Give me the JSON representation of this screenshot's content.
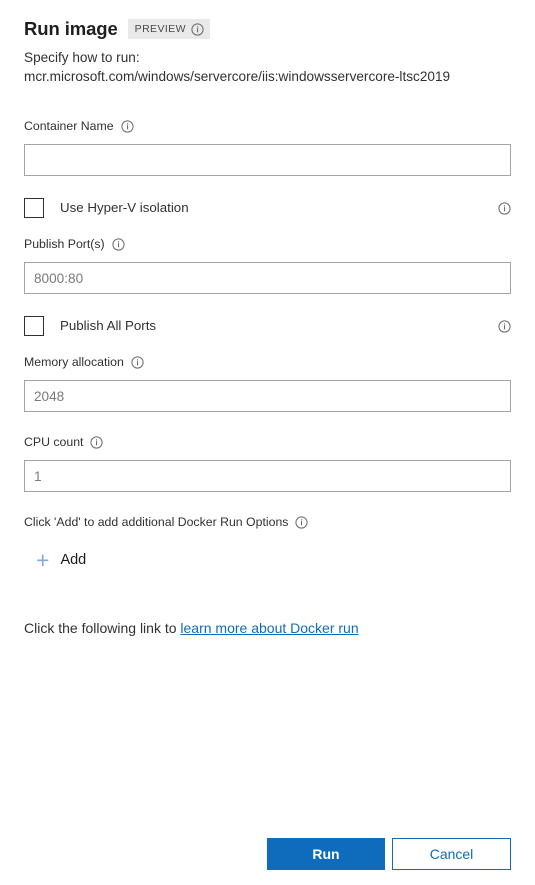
{
  "header": {
    "title": "Run image",
    "preview_badge": "PREVIEW",
    "preview_info_icon": "info-icon",
    "subtitle_line1": "Specify how to run:",
    "subtitle_line2": "mcr.microsoft.com/windows/servercore/iis:windowsservercore-ltsc2019"
  },
  "fields": {
    "container_name": {
      "label": "Container Name",
      "info_icon": "info-icon",
      "value": "",
      "placeholder": ""
    },
    "hyperv_isolation": {
      "label": "Use Hyper-V isolation",
      "checked": false,
      "info_icon": "info-icon"
    },
    "publish_ports": {
      "label": "Publish Port(s)",
      "info_icon": "info-icon",
      "value": "",
      "placeholder": "8000:80"
    },
    "publish_all_ports": {
      "label": "Publish All Ports",
      "checked": false,
      "info_icon": "info-icon"
    },
    "memory_allocation": {
      "label": "Memory allocation",
      "info_icon": "info-icon",
      "value": "",
      "placeholder": "2048"
    },
    "cpu_count": {
      "label": "CPU count",
      "info_icon": "info-icon",
      "value": "",
      "placeholder": "1"
    }
  },
  "run_options": {
    "label": "Click 'Add' to add additional Docker Run Options",
    "info_icon": "info-icon",
    "add_icon": "plus-icon",
    "add_label": "Add"
  },
  "help": {
    "prefix": "Click the following link to ",
    "link_text": "learn more about Docker run"
  },
  "footer": {
    "run_label": "Run",
    "cancel_label": "Cancel"
  },
  "colors": {
    "accent": "#0f6cbd",
    "badge_bg": "#e9e9e9",
    "text": "#323130",
    "placeholder": "#7b7a78",
    "input_border": "#a5a4a2",
    "plus": "#86aadb"
  }
}
